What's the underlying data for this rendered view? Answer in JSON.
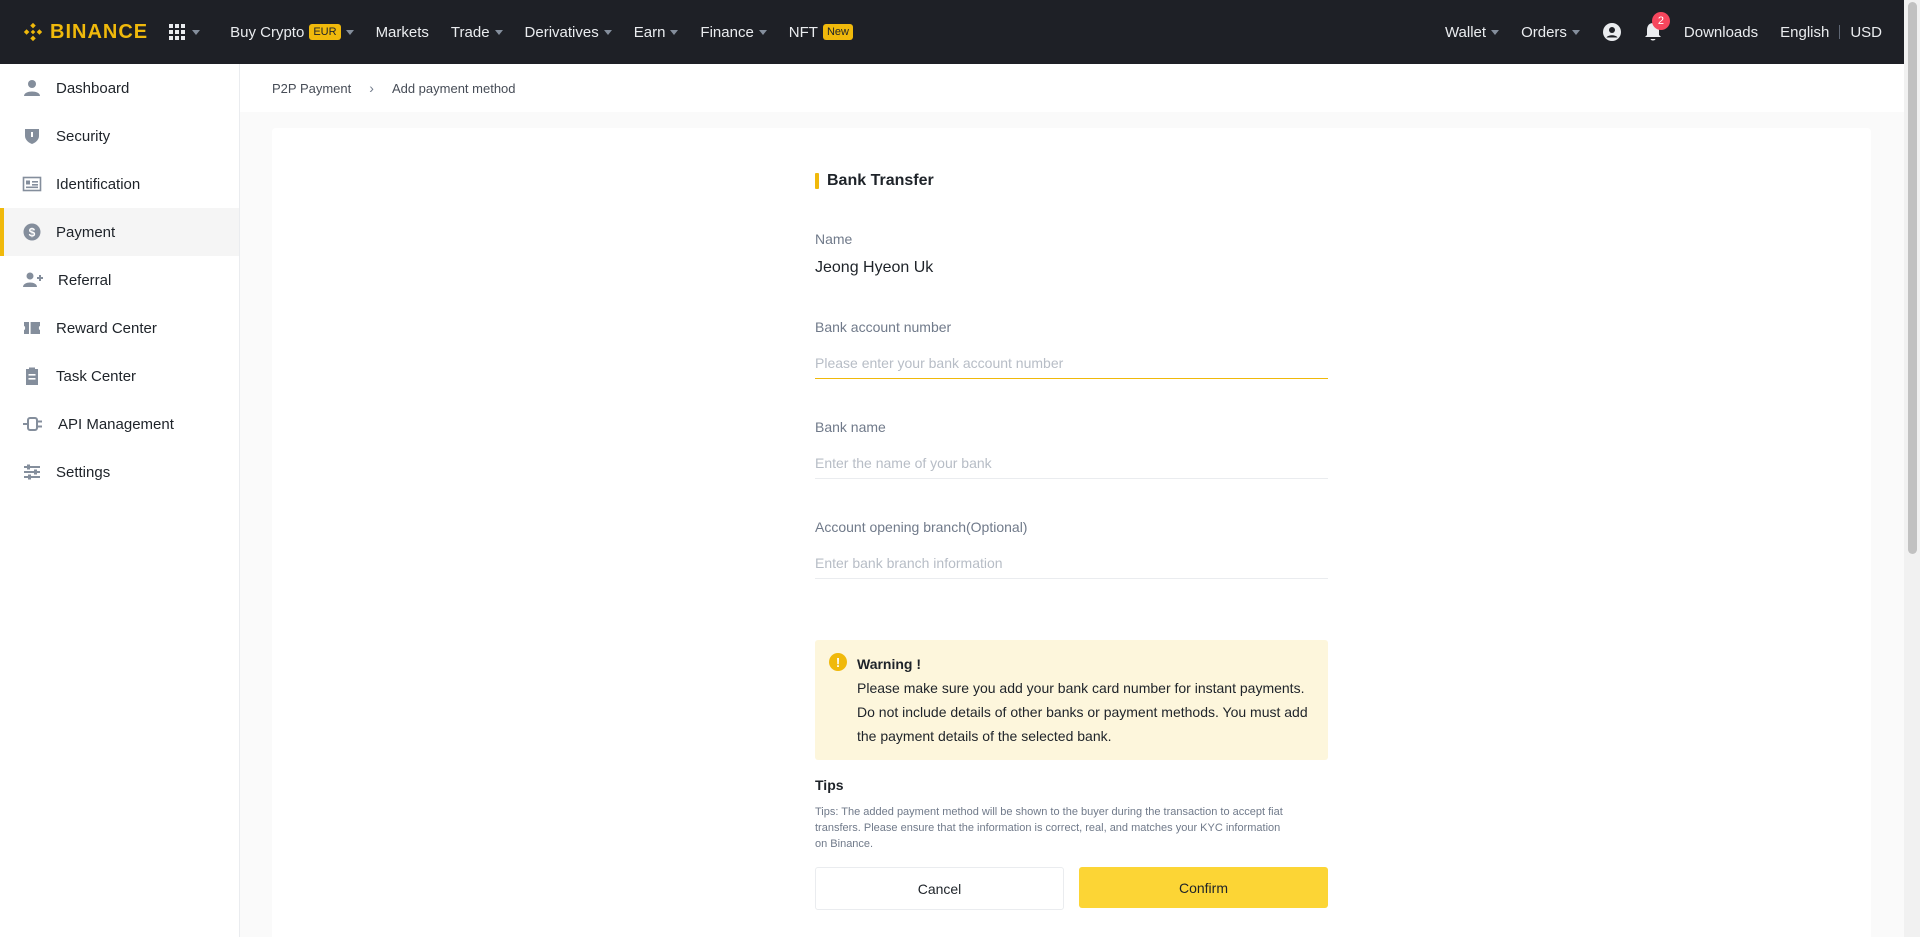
{
  "brand": {
    "name": "BINANCE",
    "accent": "#f0b90b"
  },
  "nav": {
    "buy_crypto": "Buy Crypto",
    "buy_crypto_badge": "EUR",
    "markets": "Markets",
    "trade": "Trade",
    "derivatives": "Derivatives",
    "earn": "Earn",
    "finance": "Finance",
    "nft": "NFT",
    "nft_badge": "New",
    "wallet": "Wallet",
    "orders": "Orders",
    "notification_count": "2",
    "downloads": "Downloads",
    "language": "English",
    "currency": "USD"
  },
  "sidebar": {
    "items": [
      {
        "label": "Dashboard",
        "icon": "user-icon"
      },
      {
        "label": "Security",
        "icon": "shield-icon"
      },
      {
        "label": "Identification",
        "icon": "id-card-icon"
      },
      {
        "label": "Payment",
        "icon": "dollar-icon",
        "active": true
      },
      {
        "label": "Referral",
        "icon": "add-user-icon"
      },
      {
        "label": "Reward Center",
        "icon": "ticket-icon"
      },
      {
        "label": "Task Center",
        "icon": "clipboard-icon"
      },
      {
        "label": "API Management",
        "icon": "api-icon"
      },
      {
        "label": "Settings",
        "icon": "sliders-icon"
      }
    ]
  },
  "breadcrumb": {
    "parent": "P2P Payment",
    "current": "Add payment method"
  },
  "form": {
    "title": "Bank Transfer",
    "name_label": "Name",
    "name_value": "Jeong Hyeon Uk",
    "account_label": "Bank account number",
    "account_placeholder": "Please enter your bank account number",
    "bank_label": "Bank name",
    "bank_placeholder": "Enter the name of your bank",
    "branch_label": "Account opening branch(Optional)",
    "branch_placeholder": "Enter bank branch information"
  },
  "warning": {
    "title": "Warning !",
    "line1": "Please make sure you add your bank card number for instant payments.",
    "line2": "Do not include details of other banks or payment methods. You must add",
    "line3": "the payment details of the selected bank."
  },
  "tips": {
    "title": "Tips",
    "text": "Tips: The added payment method will be shown to the buyer during the transaction to accept fiat transfers. Please ensure that the information is correct, real, and matches your KYC information on Binance."
  },
  "actions": {
    "cancel": "Cancel",
    "confirm": "Confirm"
  }
}
